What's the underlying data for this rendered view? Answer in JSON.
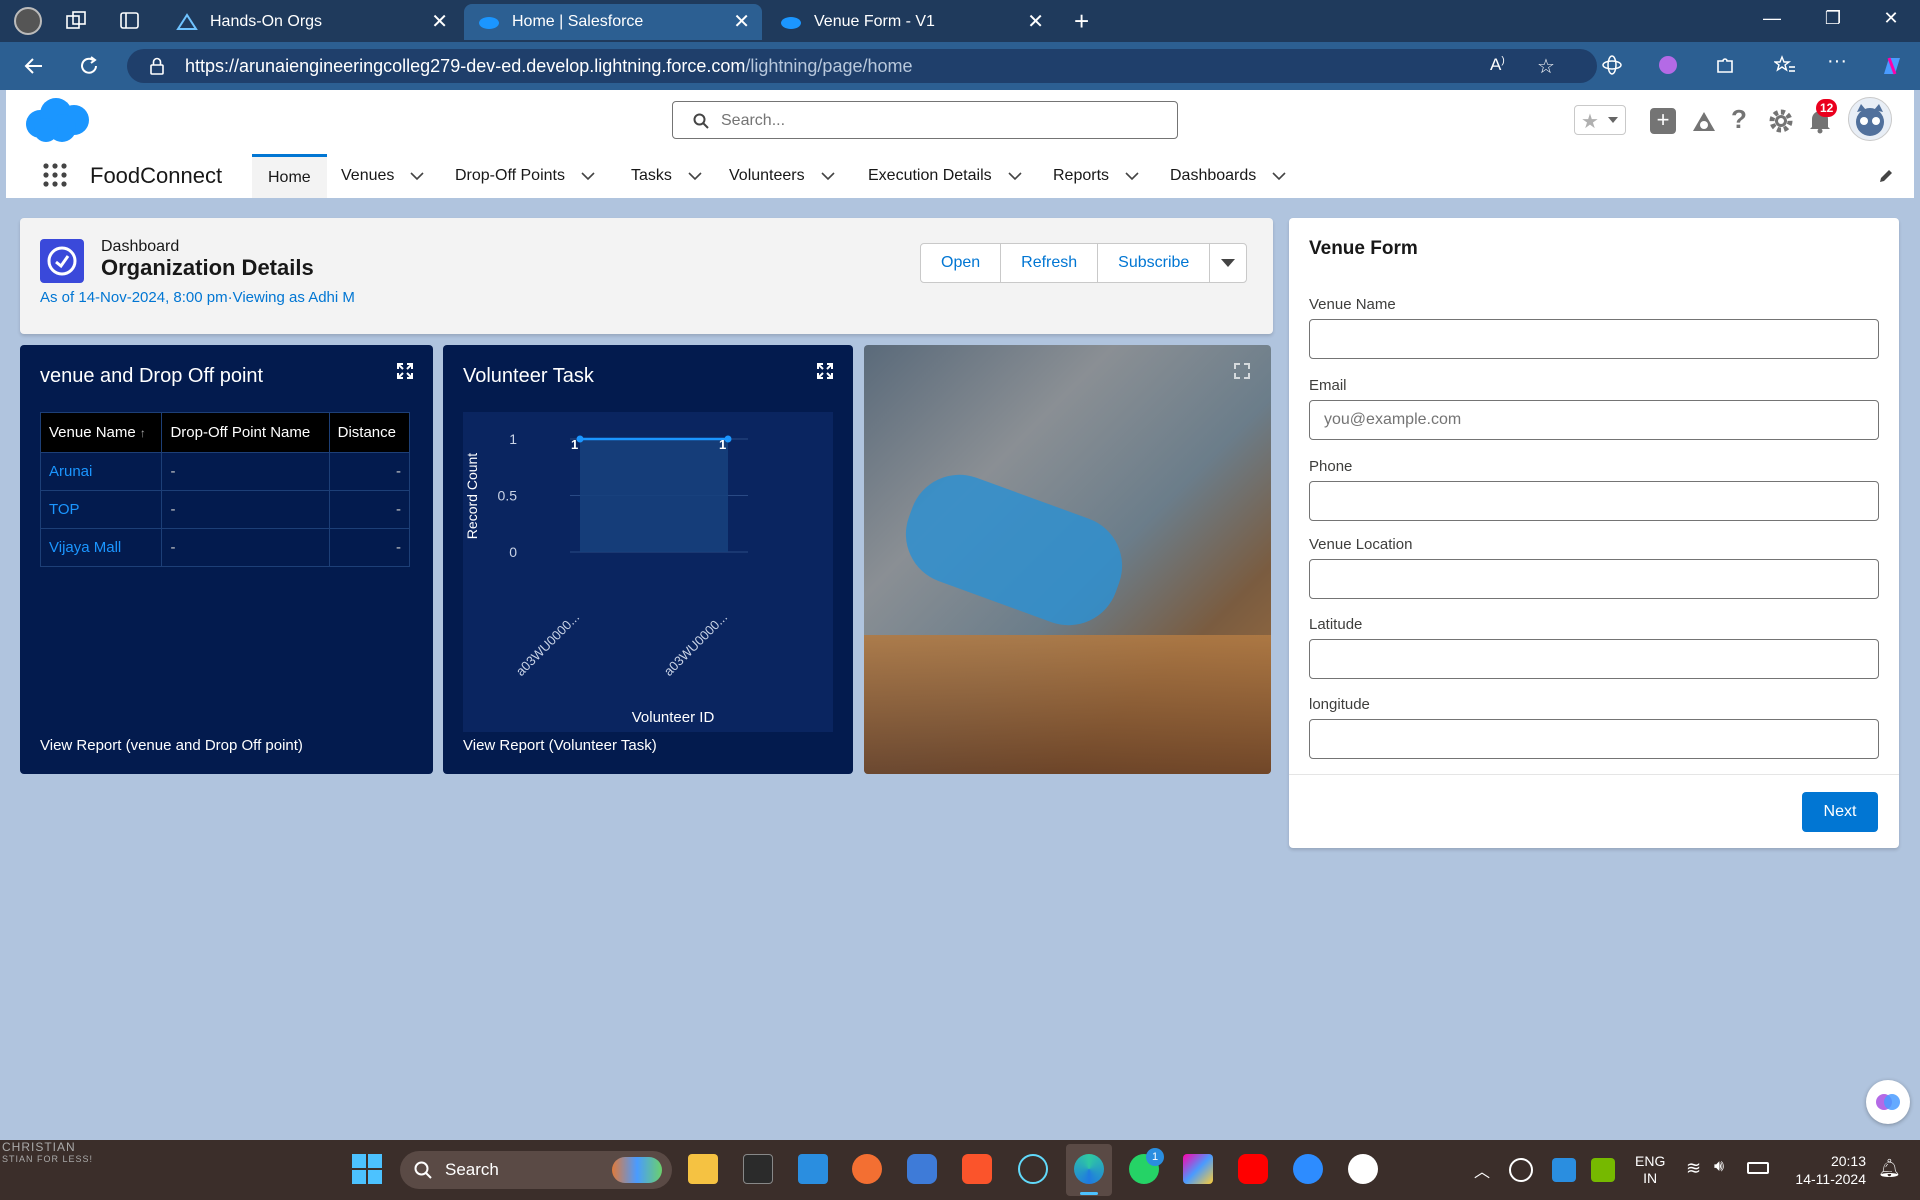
{
  "browser": {
    "tabs": [
      {
        "label": "Hands-On Orgs"
      },
      {
        "label": "Home | Salesforce"
      },
      {
        "label": "Venue Form - V1"
      }
    ],
    "url_host": "https://arunaiengineeringcolleg279-dev-ed.develop.lightning.force.com",
    "url_path": "/lightning/page/home"
  },
  "header": {
    "search_placeholder": "Search...",
    "notification_count": "12",
    "app_name": "FoodConnect"
  },
  "nav": {
    "items": [
      {
        "label": "Home"
      },
      {
        "label": "Venues"
      },
      {
        "label": "Drop-Off Points"
      },
      {
        "label": "Tasks"
      },
      {
        "label": "Volunteers"
      },
      {
        "label": "Execution Details"
      },
      {
        "label": "Reports"
      },
      {
        "label": "Dashboards"
      }
    ]
  },
  "dashboard": {
    "type_label": "Dashboard",
    "title": "Organization Details",
    "subtitle": "As of 14-Nov-2024, 8:00 pm·Viewing as Adhi M",
    "buttons": {
      "open": "Open",
      "refresh": "Refresh",
      "subscribe": "Subscribe"
    }
  },
  "venue_card": {
    "title": "venue and Drop Off point",
    "columns": [
      "Venue Name",
      "Drop-Off Point Name",
      "Distance"
    ],
    "sort_indicator": "↑",
    "rows": [
      [
        "Arunai",
        "-",
        "-"
      ],
      [
        "TOP",
        "-",
        "-"
      ],
      [
        "Vijaya Mall",
        "-",
        "-"
      ]
    ],
    "view_report": "View Report (venue and Drop Off point)"
  },
  "volunteer_card": {
    "title": "Volunteer Task",
    "view_report": "View Report (Volunteer Task)"
  },
  "chart_data": {
    "type": "area",
    "categories": [
      "a03WU0000...",
      "a03WU0000..."
    ],
    "values": [
      1,
      1
    ],
    "data_labels": [
      "1",
      "1"
    ],
    "xlabel": "Volunteer ID",
    "ylabel": "Record Count",
    "ylim": [
      0,
      1
    ],
    "yticks": [
      "0",
      "0.5",
      "1"
    ],
    "grid": true,
    "color": "#1b96ff"
  },
  "venue_form": {
    "title": "Venue Form",
    "fields": [
      {
        "label": "Venue Name",
        "value": "",
        "placeholder": ""
      },
      {
        "label": "Email",
        "value": "",
        "placeholder": "you@example.com"
      },
      {
        "label": "Phone",
        "value": "",
        "placeholder": ""
      },
      {
        "label": "Venue Location",
        "value": "",
        "placeholder": ""
      },
      {
        "label": "Latitude",
        "value": "",
        "placeholder": ""
      },
      {
        "label": "longitude",
        "value": "",
        "placeholder": ""
      }
    ],
    "next_label": "Next"
  },
  "taskbar": {
    "search_label": "Search",
    "whatsapp_badge": "1",
    "lang_primary": "ENG",
    "lang_secondary": "IN",
    "time": "20:13",
    "date": "14-11-2024",
    "wallpaper_text_1": "CHRISTIAN",
    "wallpaper_text_2": "STIAN FOR LESS!"
  },
  "colors": {
    "brand": "#0176d3",
    "dashboard_card": "#031b4e",
    "page_background": "#b0c4de",
    "tabbar": "#1f3a5c"
  }
}
